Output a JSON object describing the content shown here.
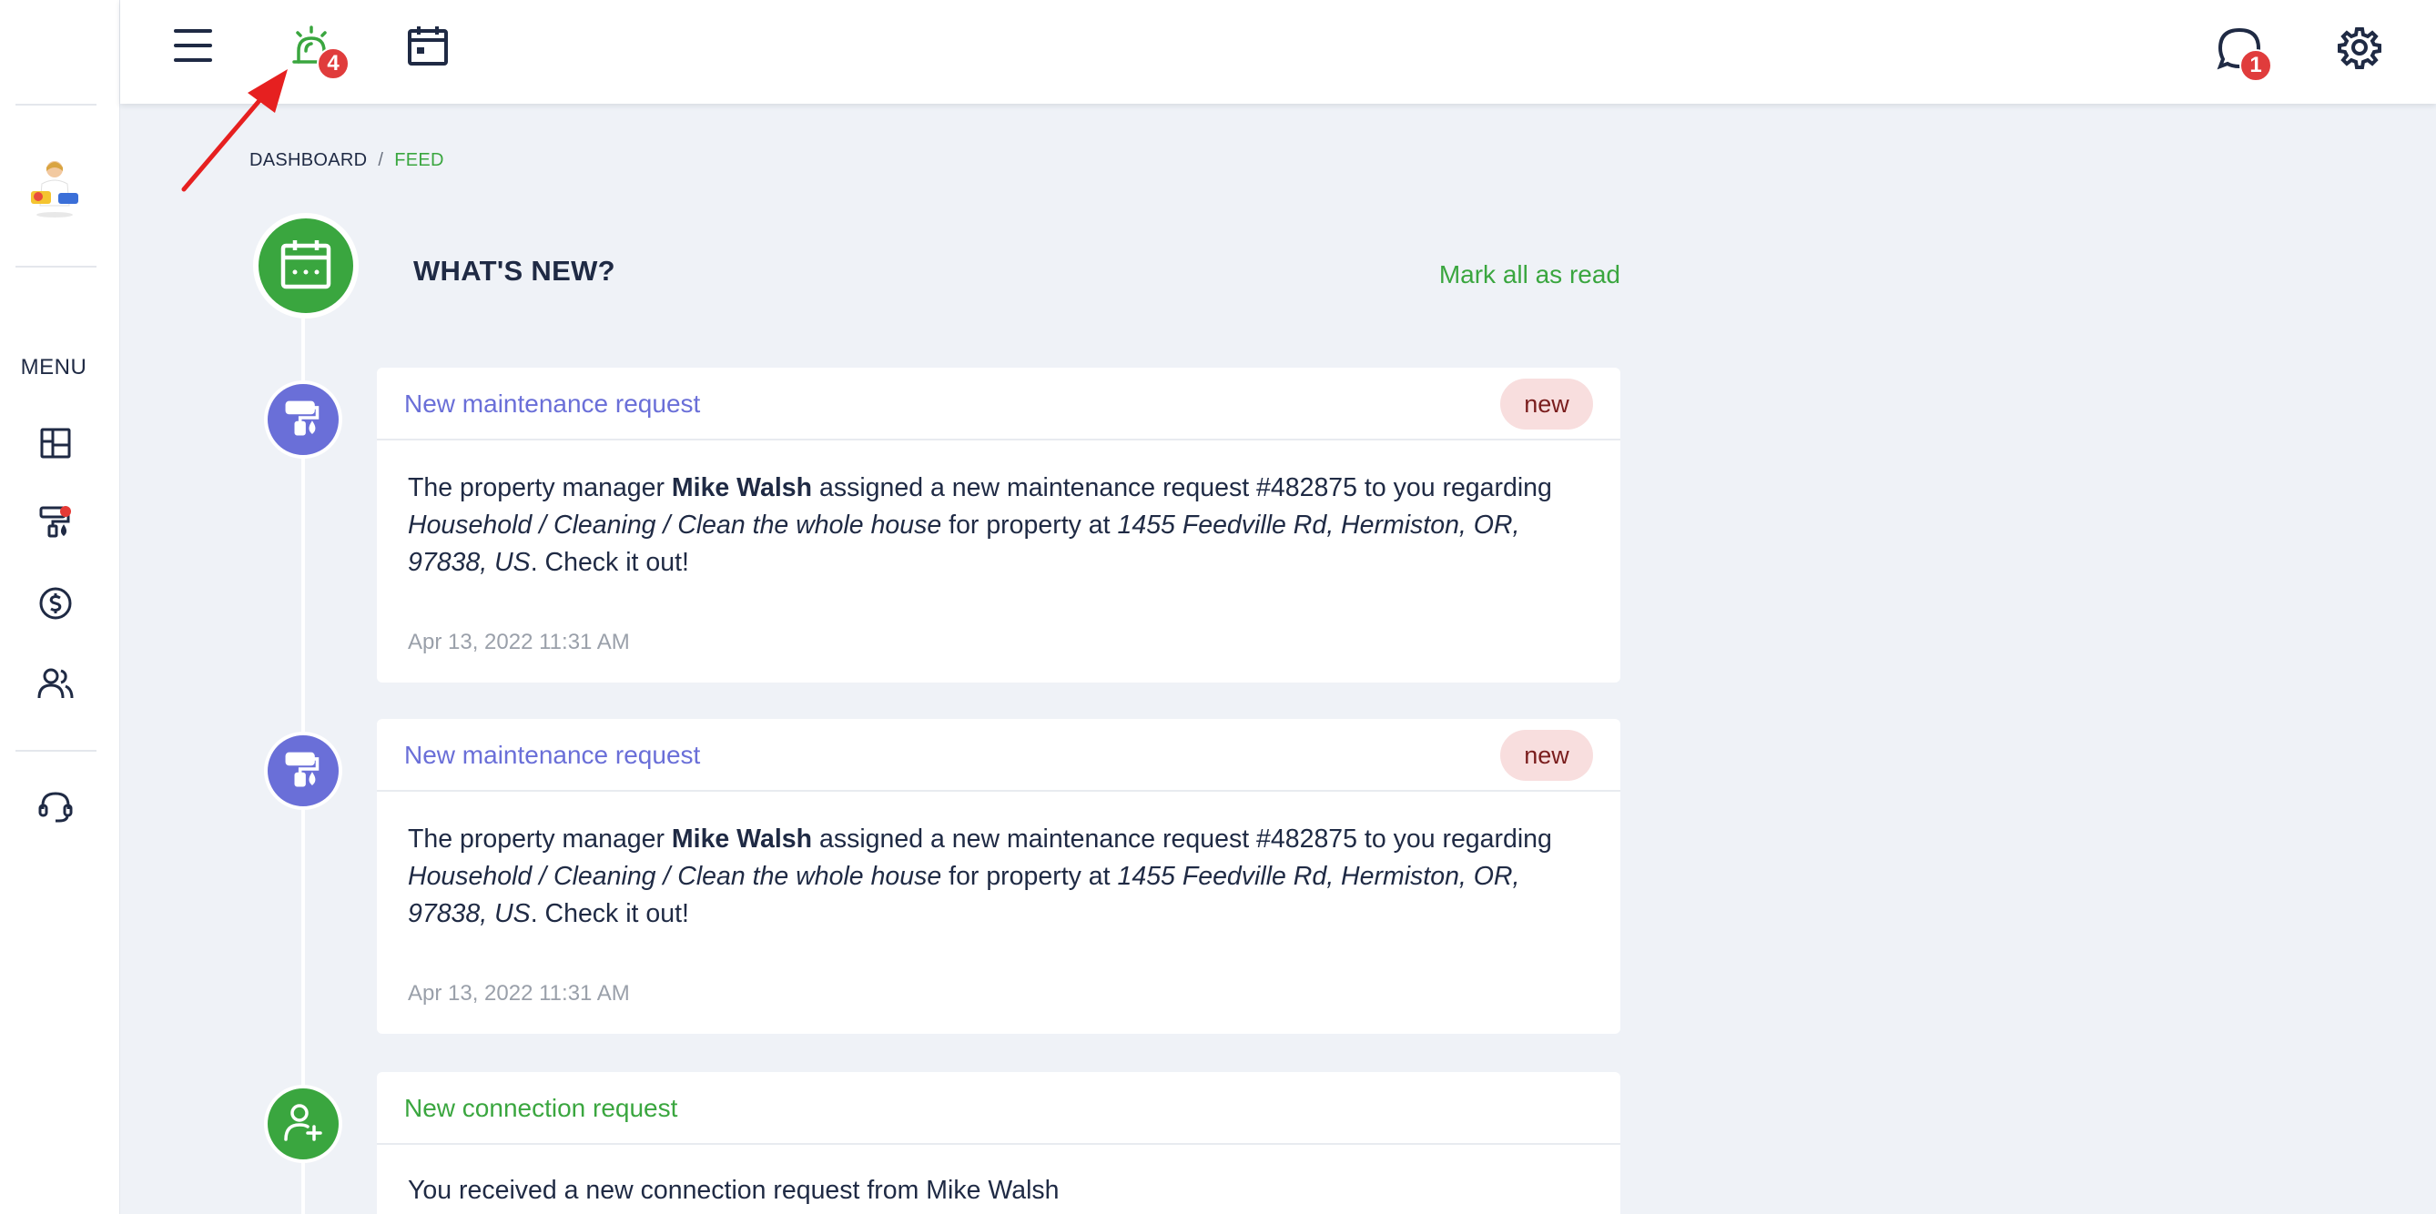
{
  "topbar": {
    "notifications_badge": "4",
    "messages_badge": "1",
    "icons": [
      "hamburger-menu-icon",
      "alarm-bell-icon",
      "calendar-icon",
      "chat-bubble-icon",
      "gear-icon"
    ],
    "accent_color": "#3aa63f",
    "badge_color": "#e03c3c"
  },
  "sidebar": {
    "menu_label": "MENU",
    "items": [
      {
        "icon": "dashboard-grid-icon"
      },
      {
        "icon": "paint-roller-icon",
        "has_dot": true
      },
      {
        "icon": "dollar-circle-icon"
      },
      {
        "icon": "users-icon"
      },
      {
        "icon": "headset-support-icon"
      }
    ]
  },
  "breadcrumb": {
    "parent": "DASHBOARD",
    "separator": "/",
    "current": "FEED"
  },
  "feed": {
    "title": "WHAT'S NEW?",
    "mark_all_read": "Mark all as read",
    "items": [
      {
        "type": "maintenance",
        "title": "New maintenance request",
        "badge": "new",
        "text_pre": "The property manager ",
        "manager": "Mike Walsh",
        "text_mid": " assigned a new maintenance request #482875 to you regarding ",
        "category": "Household / Cleaning / Clean the whole house",
        "text_prop": " for property at ",
        "address": "1455 Feedville Rd, Hermiston, OR, 97838, US",
        "text_end": ". Check it out!",
        "date": "Apr 13, 2022 11:31 AM"
      },
      {
        "type": "maintenance",
        "title": "New maintenance request",
        "badge": "new",
        "text_pre": "The property manager ",
        "manager": "Mike Walsh",
        "text_mid": " assigned a new maintenance request #482875 to you regarding ",
        "category": "Household / Cleaning / Clean the whole house",
        "text_prop": " for property at ",
        "address": "1455 Feedville Rd, Hermiston, OR, 97838, US",
        "text_end": ". Check it out!",
        "date": "Apr 13, 2022 11:31 AM"
      },
      {
        "type": "connection",
        "title": "New connection request",
        "text": "You received a new connection request from Mike Walsh"
      }
    ]
  }
}
